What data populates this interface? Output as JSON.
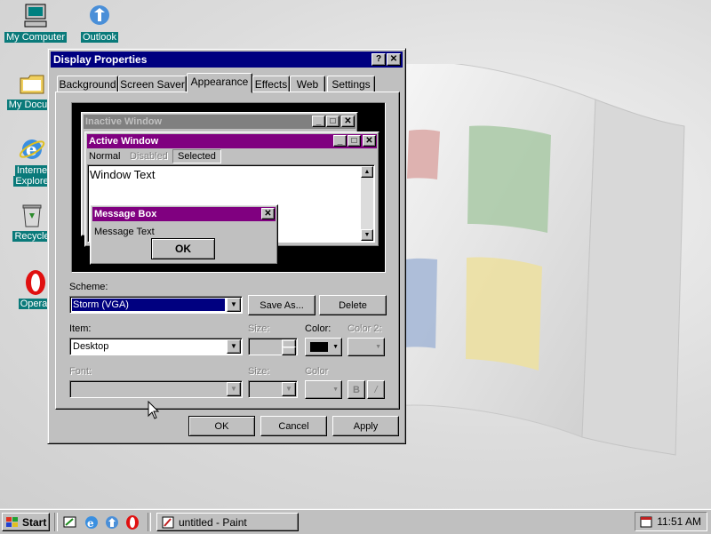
{
  "desktop": {
    "icons": [
      {
        "label": "My Computer",
        "icon": "computer-icon"
      },
      {
        "label": "Outlook",
        "icon": "outlook-icon"
      },
      {
        "label": "My Docum",
        "icon": "folder-icon"
      },
      {
        "label": "Interne",
        "label2": "Explore",
        "icon": "internet-explorer-icon"
      },
      {
        "label": "Recycle",
        "icon": "recycle-bin-icon"
      },
      {
        "label": "Opera",
        "icon": "opera-icon"
      }
    ]
  },
  "dialog": {
    "title": "Display Properties",
    "help_btn": "?",
    "close_btn": "✕",
    "tabs": [
      "Background",
      "Screen Saver",
      "Appearance",
      "Effects",
      "Web",
      "Settings"
    ],
    "active_tab": "Appearance",
    "preview": {
      "inactive_title": "Inactive Window",
      "active_title": "Active Window",
      "menu": [
        "Normal",
        "Disabled",
        "Selected"
      ],
      "window_text": "Window Text",
      "msgbox_title": "Message Box",
      "msgbox_text": "Message Text",
      "msgbox_ok": "OK"
    },
    "scheme_label": "Scheme:",
    "scheme_value": "Storm (VGA)",
    "save_as": "Save As...",
    "delete": "Delete",
    "item_label": "Item:",
    "item_value": "Desktop",
    "size_label": "Size:",
    "color_label": "Color:",
    "color2_label": "Color 2:",
    "font_label": "Font:",
    "font_size_label": "Size:",
    "font_color_label": "Color",
    "bold": "B",
    "italic": "/",
    "ok": "OK",
    "cancel": "Cancel",
    "apply": "Apply",
    "colors": {
      "title_active": "#800080",
      "title_inactive": "#808080",
      "scheme_highlight": "#000080",
      "item_color": "#000000"
    }
  },
  "taskbar": {
    "start": "Start",
    "quick_launch": [
      "show-desktop-icon",
      "internet-explorer-icon",
      "outlook-icon",
      "opera-icon"
    ],
    "task": "untitled - Paint",
    "clock": "11:51 AM"
  }
}
